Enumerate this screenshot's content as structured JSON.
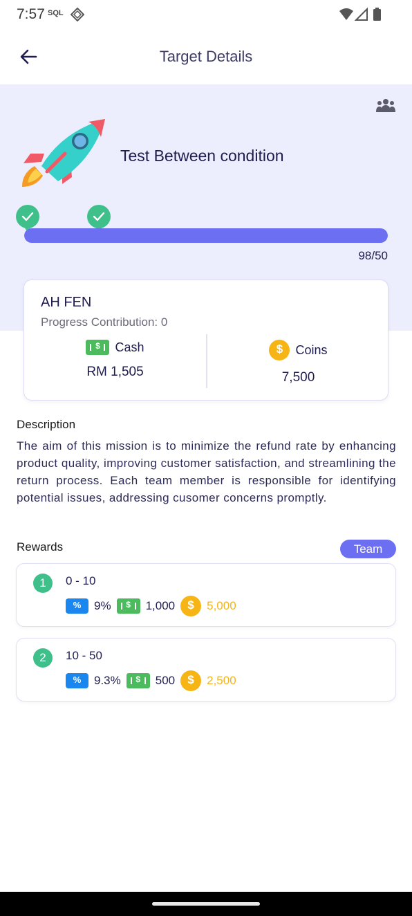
{
  "status_bar": {
    "time": "7:57",
    "sim_label": "SQL"
  },
  "header": {
    "title": "Target Details"
  },
  "target": {
    "name": "Test Between condition",
    "progress_text": "98/50",
    "progress_fraction": 1.0
  },
  "member": {
    "name": "AH FEN",
    "contribution": "Progress Contribution: 0",
    "cash_label": "Cash",
    "cash_amount": "RM 1,505",
    "coins_label": "Coins",
    "coins_amount": "7,500"
  },
  "description": {
    "title": "Description",
    "text": "The aim of this mission is to minimize the refund rate by enhancing product quality, improving customer satisfaction, and streamlining the return process. Each team member is responsible for identifying potential issues, addressing cusomer concerns promptly."
  },
  "rewards": {
    "title": "Rewards",
    "scope_label": "Team",
    "tiers": [
      {
        "index": "1",
        "range": "0 - 10",
        "percent": "9%",
        "cash": "1,000",
        "coins": "5,000"
      },
      {
        "index": "2",
        "range": "10 - 50",
        "percent": "9.3%",
        "cash": "500",
        "coins": "2,500"
      }
    ]
  },
  "icons": {
    "back": "arrow-left-icon",
    "team": "team-icon",
    "cash": "cash-icon",
    "coin": "coin-icon",
    "percent": "percent-icon",
    "check": "check-icon"
  },
  "colors": {
    "accent": "#6c6ff2",
    "success": "#3fc08a",
    "cash": "#4cbb5e",
    "coin": "#f7b515",
    "percent": "#1a86f0"
  }
}
